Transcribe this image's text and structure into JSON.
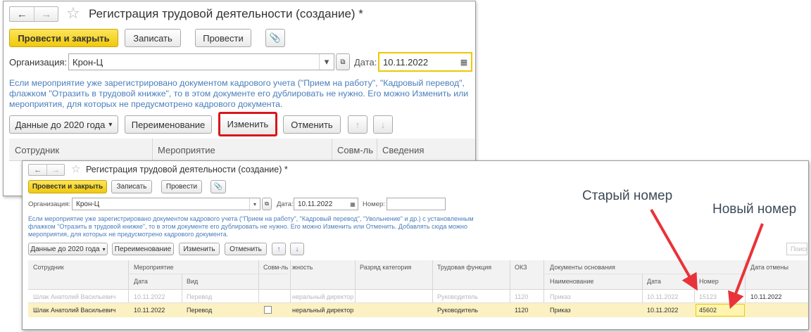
{
  "window1": {
    "title": "Регистрация трудовой деятельности (создание) *",
    "nav": {
      "back": "←",
      "forward": "→",
      "star": "☆"
    },
    "toolbar": {
      "post_close": "Провести и закрыть",
      "save": "Записать",
      "post": "Провести",
      "attach": "📎"
    },
    "org_label": "Организация:",
    "org_value": "Крон-Ц",
    "date_label": "Дата:",
    "date_value": "10.11.2022",
    "info_lines": [
      "Если мероприятие уже зарегистрировано документом кадрового учета (\"Прием на работу\", \"Кадровый перевод\",",
      "флажком \"Отразить в трудовой книжке\", то в этом документе его дублировать не нужно. Его можно Изменить или",
      "мероприятия, для которых не предусмотрено кадрового документа."
    ],
    "actions": {
      "data_before": "Данные до 2020 года",
      "rename": "Переименование",
      "change": "Изменить",
      "cancel": "Отменить",
      "up": "↑",
      "down": "↓"
    },
    "columns": [
      "Сотрудник",
      "Мероприятие",
      "Совм-ль",
      "Сведения"
    ]
  },
  "window2": {
    "title": "Регистрация трудовой деятельности (создание) *",
    "nav": {
      "back": "←",
      "forward": "→"
    },
    "toolbar": {
      "post_close": "Провести и закрыть",
      "save": "Записать",
      "post": "Провести",
      "attach": "📎"
    },
    "org_label": "Организация:",
    "org_value": "Крон-Ц",
    "date_label": "Дата:",
    "date_value": "10.11.2022",
    "number_label": "Номер:",
    "number_value": "",
    "info_lines": [
      "Если мероприятие уже зарегистрировано документом кадрового учета (\"Прием на работу\", \"Кадровый перевод\", \"Увольнение\" и др.) с установленным",
      "флажком \"Отразить в трудовой книжке\", то в этом документе его дублировать не нужно. Его можно Изменить или Отменить. Добавлять сюда можно",
      "мероприятия, для которых не предусмотрено кадрового документа."
    ],
    "actions": {
      "data_before": "Данные до 2020 года",
      "rename": "Переименование",
      "change": "Изменить",
      "cancel": "Отменить",
      "up": "↑",
      "down": "↓"
    },
    "search_placeholder": "Поиск",
    "headers": {
      "employee": "Сотрудник",
      "event": "Мероприятие",
      "event_date": "Дата",
      "event_kind": "Вид",
      "combined": "Совм-ль",
      "position": "жность",
      "category": "Разряд категория",
      "function": "Трудовая функция",
      "okz": "ОКЗ",
      "basis_docs": "Документы основания",
      "doc_name": "Наименование",
      "doc_date": "Дата",
      "doc_number": "Номер",
      "cancel_date": "Дата отмены"
    },
    "rows": [
      {
        "employee": "Шлак Анатолий Васильевич",
        "date": "10.11.2022",
        "kind": "Перевод",
        "position": "неральный директор",
        "function": "Руководитель",
        "okz": "1120",
        "doc_name": "Приказ",
        "doc_date": "10.11.2022",
        "doc_number": "15123",
        "cancel_date": "10.11.2022"
      },
      {
        "employee": "Шлак Анатолий Васильевич",
        "date": "10.11.2022",
        "kind": "Перевод",
        "position": "неральный директор",
        "function": "Руководитель",
        "okz": "1120",
        "doc_name": "Приказ",
        "doc_date": "10.11.2022",
        "doc_number": "45602",
        "cancel_date": ""
      }
    ]
  },
  "annotations": {
    "old_number": "Старый номер",
    "new_number": "Новый номер"
  },
  "colors": {
    "accent_yellow": "#f5d21d",
    "highlight_red": "#d8161c",
    "arrow_red": "#e8333a",
    "info_blue": "#4a7ebb"
  }
}
